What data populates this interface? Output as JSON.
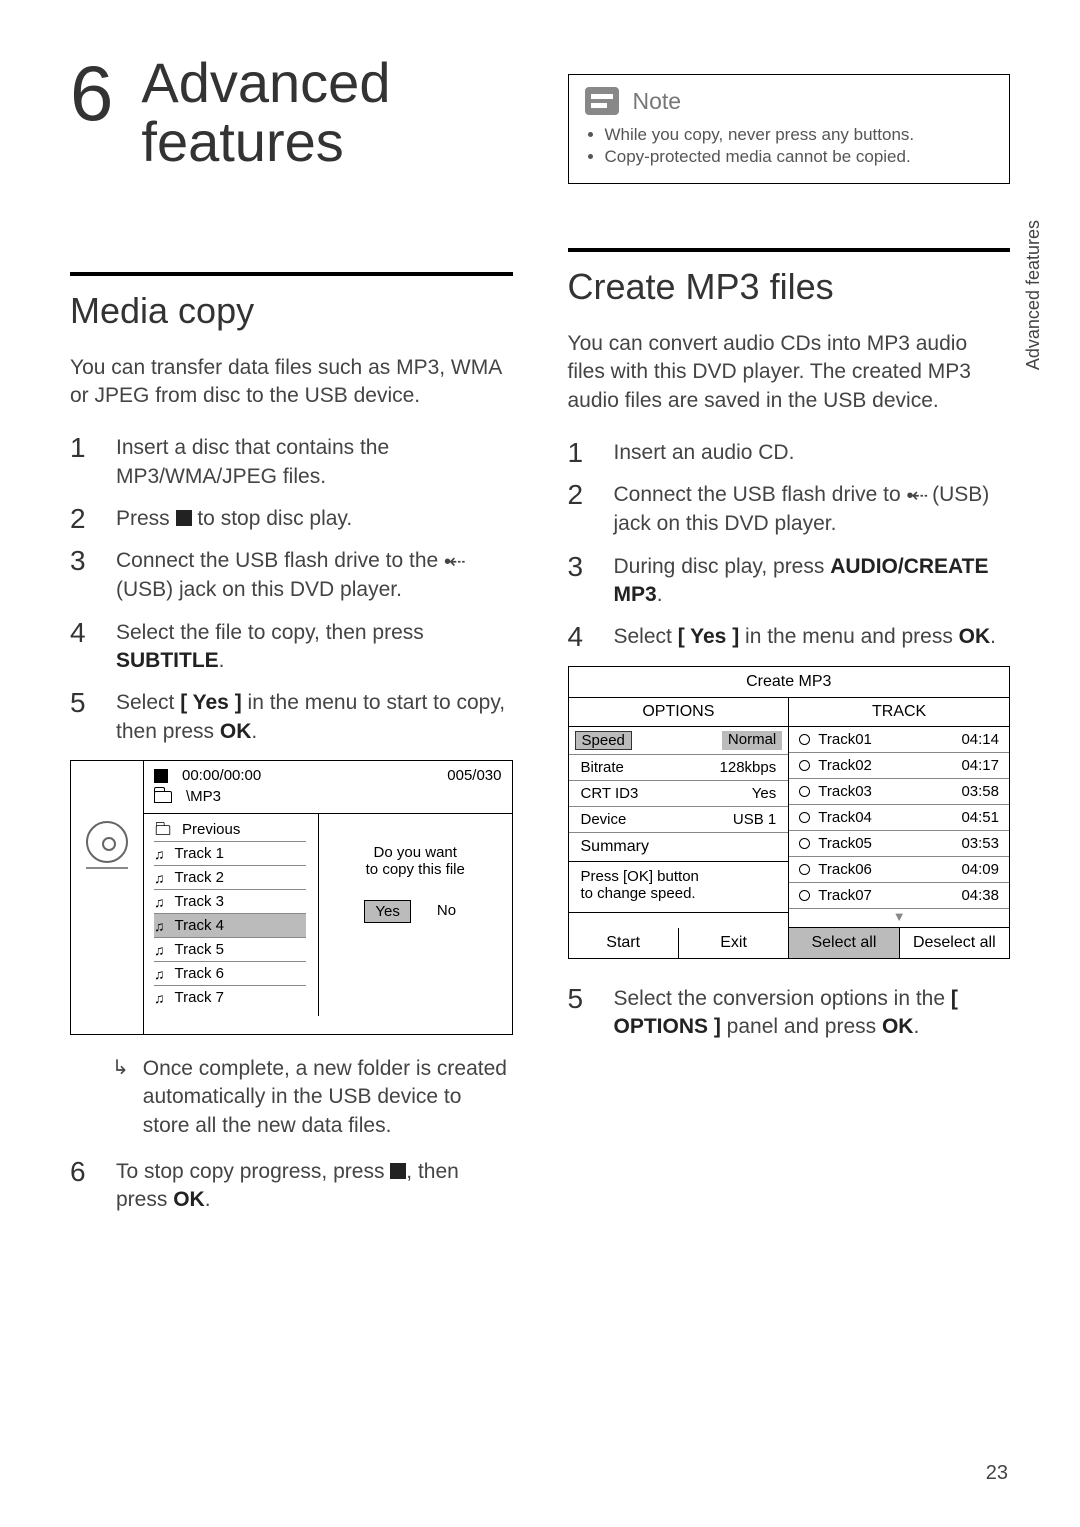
{
  "page_number": "23",
  "side_tab": "Advanced features",
  "chapter": {
    "num": "6",
    "title_a": "Advanced",
    "title_b": "features"
  },
  "left": {
    "section": "Media copy",
    "intro": "You can transfer data files such as MP3, WMA or JPEG from disc to the USB device.",
    "steps": {
      "s1": "Insert a disc that contains the MP3/WMA/JPEG files.",
      "s2a": "Press ",
      "s2b": " to stop disc play.",
      "s3a": "Connect the USB flash drive to the ",
      "s3b": " (USB) jack on this DVD player.",
      "s4a": "Select the file to copy, then press ",
      "s4b": "SUBTITLE",
      "s4c": ".",
      "s5a": "Select ",
      "s5b": "[ Yes ]",
      "s5c": " in the menu to start to copy, then press ",
      "s5d": "OK",
      "s5e": ".",
      "s6a": "To stop copy progress, press ",
      "s6b": ", then press ",
      "s6c": "OK",
      "s6d": "."
    },
    "result": "Once complete, a new folder is created automatically in the USB device to store all the new data files.",
    "fig": {
      "time": "00:00/00:00",
      "index": "005/030",
      "folder": "\\MP3",
      "previous": "Previous",
      "tracks": [
        "Track 1",
        "Track 2",
        "Track 3",
        "Track 4",
        "Track 5",
        "Track 6",
        "Track 7"
      ],
      "sel_index": 3,
      "prompt1": "Do you want",
      "prompt2": "to copy this file",
      "yes": "Yes",
      "no": "No"
    }
  },
  "right": {
    "note_label": "Note",
    "notes": [
      "While you copy, never press any buttons.",
      "Copy-protected media cannot be copied."
    ],
    "section": "Create MP3 files",
    "intro": "You can convert audio CDs into MP3 audio files with this DVD player. The created MP3 audio files are saved in the USB device.",
    "steps": {
      "s1": "Insert an audio CD.",
      "s2a": "Connect the USB flash drive to ",
      "s2b": " (USB) jack on this DVD player.",
      "s3a": "During disc play, press ",
      "s3b": "AUDIO/CREATE MP3",
      "s3c": ".",
      "s4a": "Select ",
      "s4b": "[ Yes ]",
      "s4c": " in the menu and press ",
      "s4d": "OK",
      "s4e": ".",
      "s5a": "Select the conversion options in the ",
      "s5b": "[ OPTIONS ]",
      "s5c": " panel and press ",
      "s5d": "OK",
      "s5e": "."
    },
    "fig": {
      "title": "Create MP3",
      "h_options": "OPTIONS",
      "h_track": "TRACK",
      "opts": [
        {
          "k": "Speed",
          "v": "Normal",
          "sel": true
        },
        {
          "k": "Bitrate",
          "v": "128kbps"
        },
        {
          "k": "CRT ID3",
          "v": "Yes"
        },
        {
          "k": "Device",
          "v": "USB 1"
        }
      ],
      "summary": "Summary",
      "hint1": "Press [OK] button",
      "hint2": "to change speed.",
      "tracks": [
        {
          "n": "Track01",
          "t": "04:14"
        },
        {
          "n": "Track02",
          "t": "04:17"
        },
        {
          "n": "Track03",
          "t": "03:58"
        },
        {
          "n": "Track04",
          "t": "04:51"
        },
        {
          "n": "Track05",
          "t": "03:53"
        },
        {
          "n": "Track06",
          "t": "04:09"
        },
        {
          "n": "Track07",
          "t": "04:38"
        }
      ],
      "foot": [
        "Start",
        "Exit",
        "Select all",
        "Deselect all"
      ],
      "foot_sel": 2
    }
  }
}
